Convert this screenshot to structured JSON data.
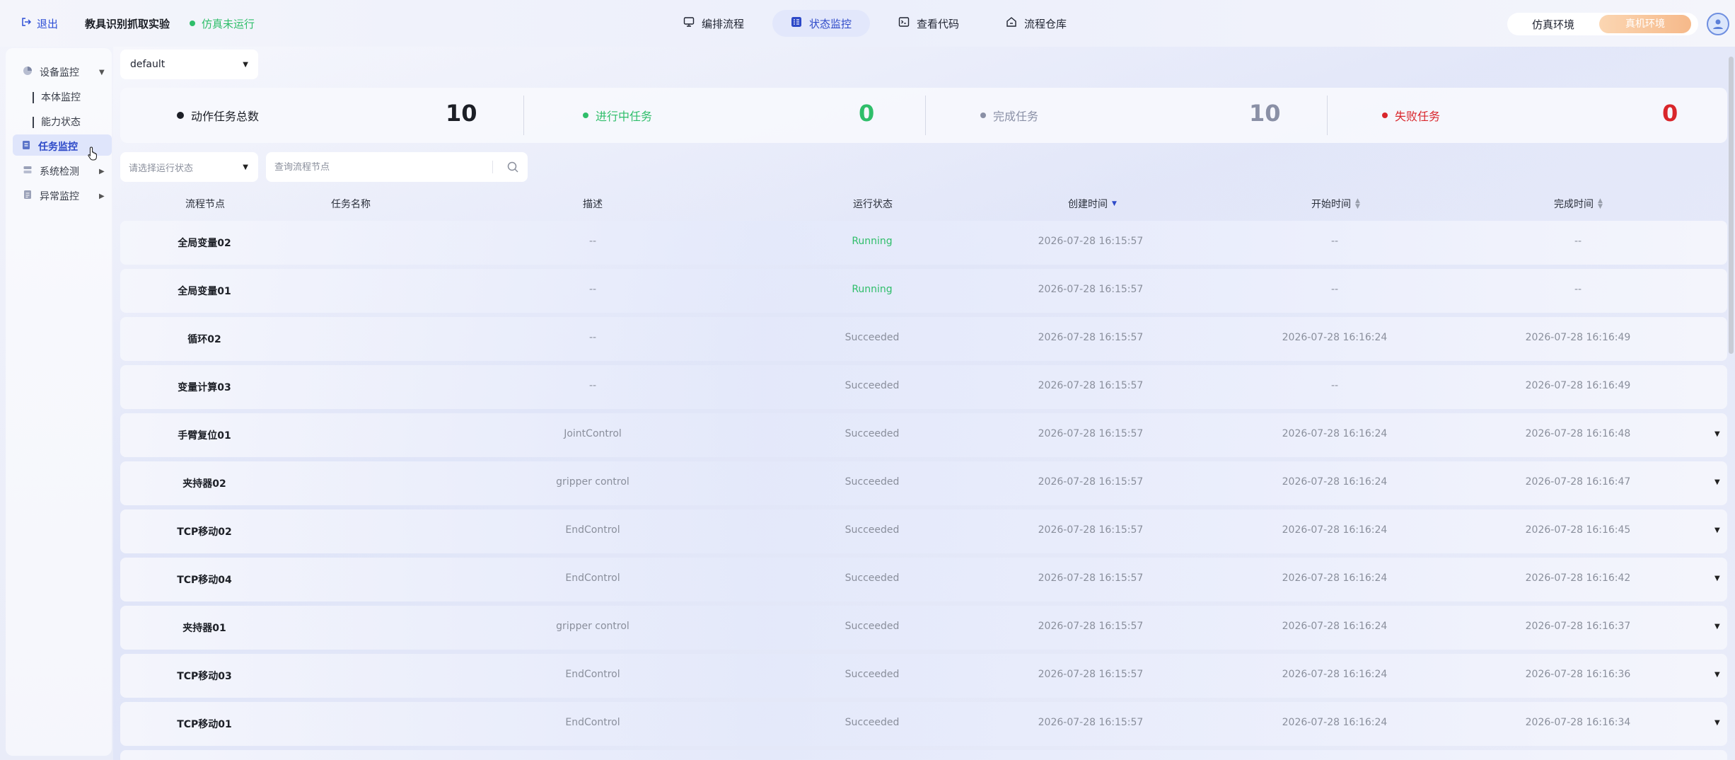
{
  "topbar": {
    "logout_label": "退出",
    "experiment_title": "教具识别抓取实验",
    "sim_status": "仿真未运行",
    "sim_status_color": "#2fbe6a",
    "tabs": [
      {
        "label": "编排流程",
        "icon": "monitor-icon"
      },
      {
        "label": "状态监控",
        "icon": "list-check-icon",
        "active": true
      },
      {
        "label": "查看代码",
        "icon": "terminal-icon"
      },
      {
        "label": "流程仓库",
        "icon": "home-box-icon"
      }
    ],
    "env_sim_label": "仿真环境",
    "env_real_label": "真机环境"
  },
  "sidebar": {
    "items": [
      {
        "label": "设备监控",
        "icon": "pie-chart-icon",
        "expanded": true
      },
      {
        "label": "本体监控"
      },
      {
        "label": "能力状态"
      },
      {
        "label": "任务监控",
        "icon": "task-icon",
        "active": true
      },
      {
        "label": "系统检测",
        "icon": "server-icon"
      },
      {
        "label": "异常监控",
        "icon": "alert-doc-icon"
      }
    ]
  },
  "workspace_select": {
    "value": "default"
  },
  "stats": {
    "total": {
      "label": "动作任务总数",
      "value": "10",
      "color": "#1c1f26"
    },
    "running": {
      "label": "进行中任务",
      "value": "0",
      "color": "#2fbe6a"
    },
    "completed": {
      "label": "完成任务",
      "value": "10",
      "color": "#8a90a6"
    },
    "failed": {
      "label": "失败任务",
      "value": "0",
      "color": "#d9262b"
    }
  },
  "filters": {
    "status_placeholder": "请选择运行状态",
    "search_placeholder": "查询流程节点"
  },
  "table": {
    "headers": {
      "node": "流程节点",
      "task_name": "任务名称",
      "desc": "描述",
      "status": "运行状态",
      "created": "创建时间",
      "start": "开始时间",
      "end": "完成时间"
    },
    "rows": [
      {
        "node": "全局变量02",
        "desc": "--",
        "status": "Running",
        "created": "2026-07-28 16:15:57",
        "start": "--",
        "end": "--",
        "expandable": false
      },
      {
        "node": "全局变量01",
        "desc": "--",
        "status": "Running",
        "created": "2026-07-28 16:15:57",
        "start": "--",
        "end": "--",
        "expandable": false
      },
      {
        "node": "循环02",
        "desc": "--",
        "status": "Succeeded",
        "created": "2026-07-28 16:15:57",
        "start": "2026-07-28 16:16:24",
        "end": "2026-07-28 16:16:49",
        "expandable": false
      },
      {
        "node": "变量计算03",
        "desc": "--",
        "status": "Succeeded",
        "created": "2026-07-28 16:15:57",
        "start": "--",
        "end": "2026-07-28 16:16:49",
        "expandable": false
      },
      {
        "node": "手臂复位01",
        "desc": "JointControl",
        "status": "Succeeded",
        "created": "2026-07-28 16:15:57",
        "start": "2026-07-28 16:16:24",
        "end": "2026-07-28 16:16:48",
        "expandable": true
      },
      {
        "node": "夹持器02",
        "desc": "gripper control",
        "status": "Succeeded",
        "created": "2026-07-28 16:15:57",
        "start": "2026-07-28 16:16:24",
        "end": "2026-07-28 16:16:47",
        "expandable": true
      },
      {
        "node": "TCP移动02",
        "desc": "EndControl",
        "status": "Succeeded",
        "created": "2026-07-28 16:15:57",
        "start": "2026-07-28 16:16:24",
        "end": "2026-07-28 16:16:45",
        "expandable": true
      },
      {
        "node": "TCP移动04",
        "desc": "EndControl",
        "status": "Succeeded",
        "created": "2026-07-28 16:15:57",
        "start": "2026-07-28 16:16:24",
        "end": "2026-07-28 16:16:42",
        "expandable": true
      },
      {
        "node": "夹持器01",
        "desc": "gripper control",
        "status": "Succeeded",
        "created": "2026-07-28 16:15:57",
        "start": "2026-07-28 16:16:24",
        "end": "2026-07-28 16:16:37",
        "expandable": true
      },
      {
        "node": "TCP移动03",
        "desc": "EndControl",
        "status": "Succeeded",
        "created": "2026-07-28 16:15:57",
        "start": "2026-07-28 16:16:24",
        "end": "2026-07-28 16:16:36",
        "expandable": true
      },
      {
        "node": "TCP移动01",
        "desc": "EndControl",
        "status": "Succeeded",
        "created": "2026-07-28 16:15:57",
        "start": "2026-07-28 16:16:24",
        "end": "2026-07-28 16:16:34",
        "expandable": true
      }
    ]
  }
}
